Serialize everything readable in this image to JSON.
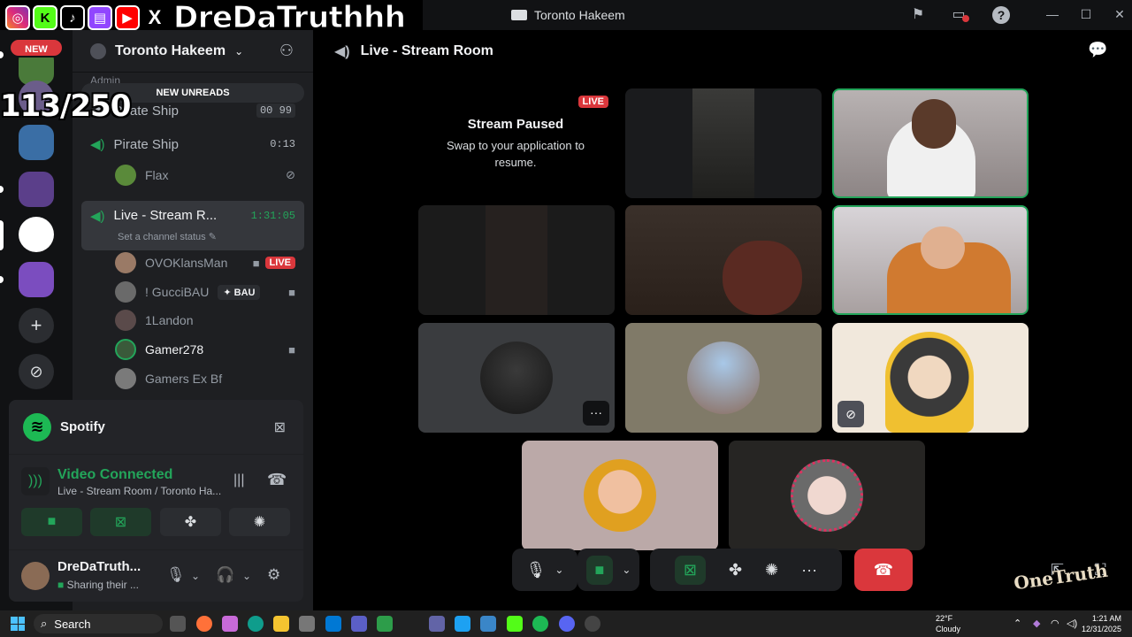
{
  "window": {
    "title": "Toronto Hakeem",
    "controls": [
      "—",
      "☐",
      "✕"
    ]
  },
  "overlay": {
    "handle": "DreDaTruthhh",
    "counter": "113/250",
    "social_icons": [
      "instagram-icon",
      "kick-icon",
      "tiktok-icon",
      "twitch-icon",
      "youtube-icon",
      "x-icon"
    ]
  },
  "rail": {
    "new_label": "NEW"
  },
  "sidebar": {
    "server_name": "Toronto Hakeem",
    "category": "Admin",
    "new_unreads": "NEW UNREADS",
    "channels": [
      {
        "name": "Pirate Ship",
        "badge": "00  99"
      },
      {
        "name": "Pirate Ship",
        "timer": "0:13"
      },
      {
        "name": "Live - Stream R...",
        "timer": "1:31:05",
        "status": "Set a channel status"
      }
    ],
    "members": [
      {
        "name": "Flax"
      },
      {
        "name": "OVOKlansMan",
        "tag": "LIVE"
      },
      {
        "name": "! GucciBAU",
        "tag": "BAU"
      },
      {
        "name": "1Landon"
      },
      {
        "name": "Gamer278"
      },
      {
        "name": "Gamers Ex Bf"
      }
    ]
  },
  "panel": {
    "activity": "Spotify",
    "voice_status": "Video Connected",
    "voice_location": "Live - Stream Room / Toronto Ha...",
    "user_name": "DreDaTruth...",
    "user_status": "Sharing their ..."
  },
  "main": {
    "channel_header": "Live - Stream Room",
    "paused_title": "Stream Paused",
    "paused_desc": "Swap to your application to resume.",
    "live_tag": "LIVE",
    "more": "···"
  },
  "taskbar": {
    "search": "Search",
    "weather_temp": "22°F",
    "weather_desc": "Cloudy",
    "time": "1:21 AM",
    "date": "12/31/2025"
  },
  "branding": {
    "corner_logo": "OneTruth"
  },
  "colors": {
    "accent_green": "#23a55a",
    "live_red": "#da373c",
    "hangup_red": "#da373c",
    "spotify_green": "#1db954"
  }
}
